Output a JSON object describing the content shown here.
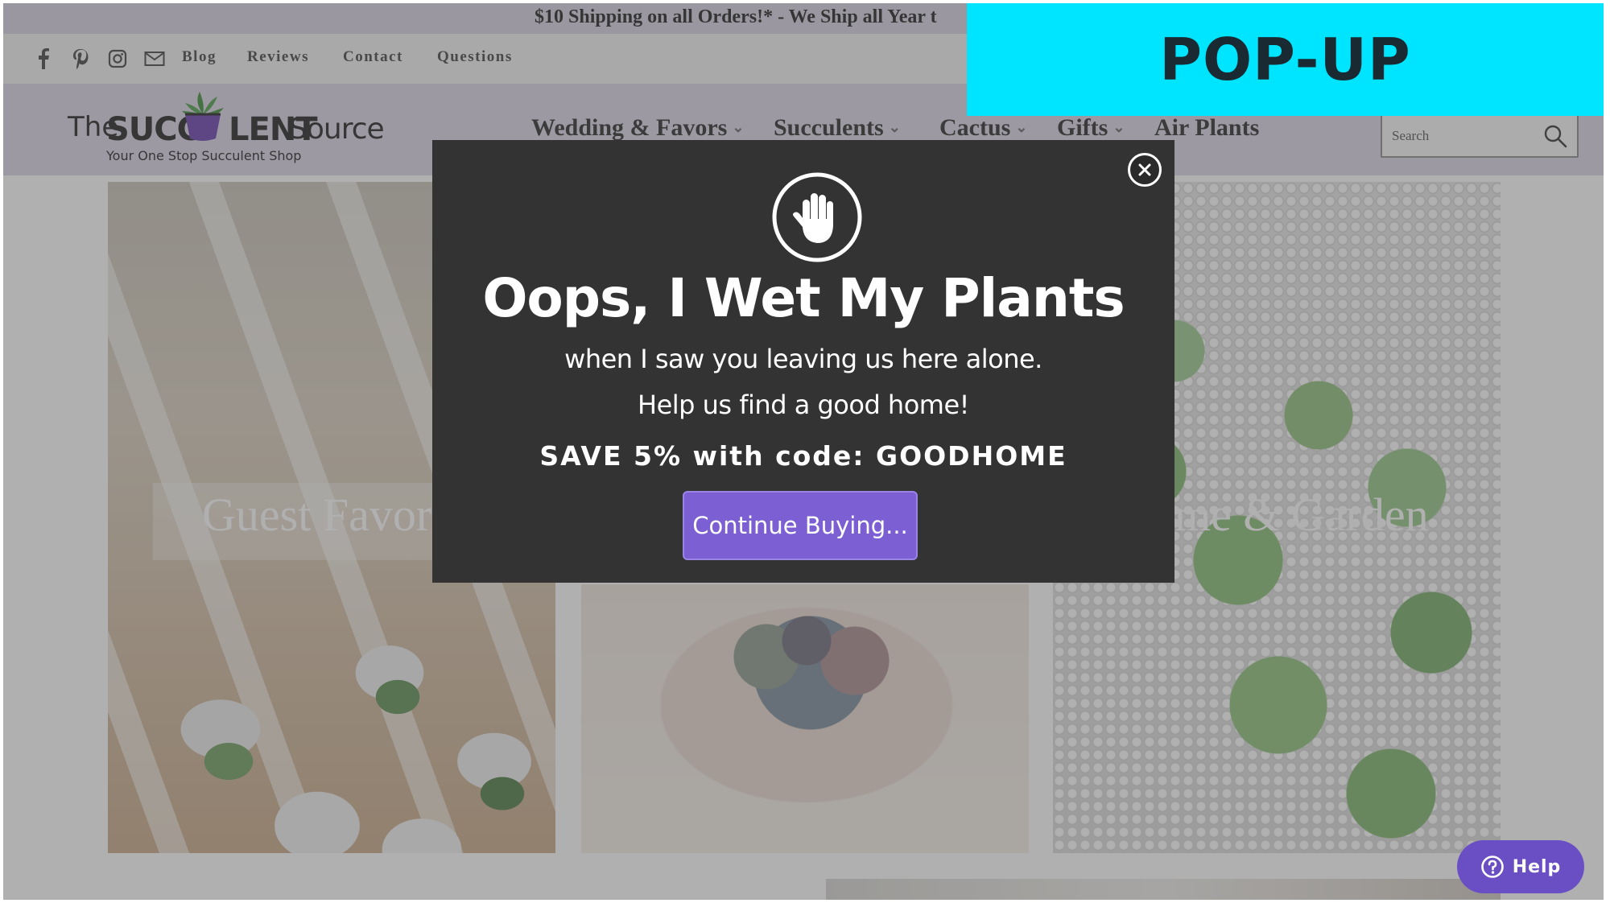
{
  "announcement": {
    "text": "$10 Shipping on all Orders!* - We Ship all Year t"
  },
  "utility": {
    "social_icons": [
      "facebook-icon",
      "pinterest-icon",
      "instagram-icon",
      "mail-icon"
    ],
    "links": [
      "Blog",
      "Reviews",
      "Contact",
      "Questions"
    ]
  },
  "logo": {
    "the": "The",
    "succ": "SUCC",
    "lent": "LENT",
    "source": "Source",
    "tagline": "Your One Stop Succulent Shop"
  },
  "nav": {
    "items": [
      "Wedding & Favors",
      "Succulents",
      "Cactus",
      "Gifts",
      "Air Plants"
    ]
  },
  "search": {
    "placeholder": "Search"
  },
  "tiles": {
    "guest_favors": "Guest Favor",
    "home_garden": "me & Garden"
  },
  "popup": {
    "title": "Oops, I Wet My Plants",
    "line1": "when I saw you leaving us here alone.",
    "line2": "Help us find a good home!",
    "code_text": "SAVE 5% with code: GOODHOME",
    "button": "Continue Buying..."
  },
  "annotation": {
    "label": "POP-UP"
  },
  "help": {
    "label": "Help"
  },
  "colors": {
    "accent": "#7c5fd3",
    "annotation": "#00e5ff",
    "header": "#ddd5e6",
    "modal": "#333333"
  }
}
